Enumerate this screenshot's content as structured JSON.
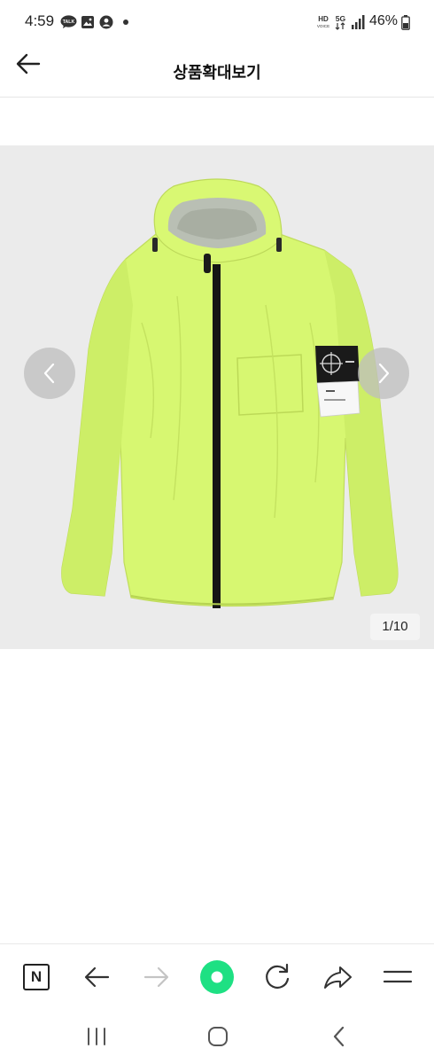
{
  "status_bar": {
    "time": "4:59",
    "talk_badge": "TALK",
    "network_type": "5G",
    "hd_label": "HD",
    "voice_label": "VOICE",
    "battery_percent": "46%"
  },
  "header": {
    "title": "상품확대보기",
    "back_icon": "arrow-left-icon"
  },
  "viewer": {
    "counter": "1/10",
    "prev_icon": "chevron-left-icon",
    "next_icon": "chevron-right-icon",
    "product_image": "neon yellow-green hooded jacket with black zipper and black compass arm badge"
  },
  "browser_toolbar": {
    "home_label": "N",
    "items": [
      "naver-home-icon",
      "back-arrow-icon",
      "forward-arrow-icon",
      "green-dot-icon",
      "refresh-icon",
      "share-icon",
      "menu-icon"
    ],
    "accent_color": "#1ee083"
  },
  "system_nav": {
    "items": [
      "recent-apps-icon",
      "home-icon",
      "back-icon"
    ]
  }
}
